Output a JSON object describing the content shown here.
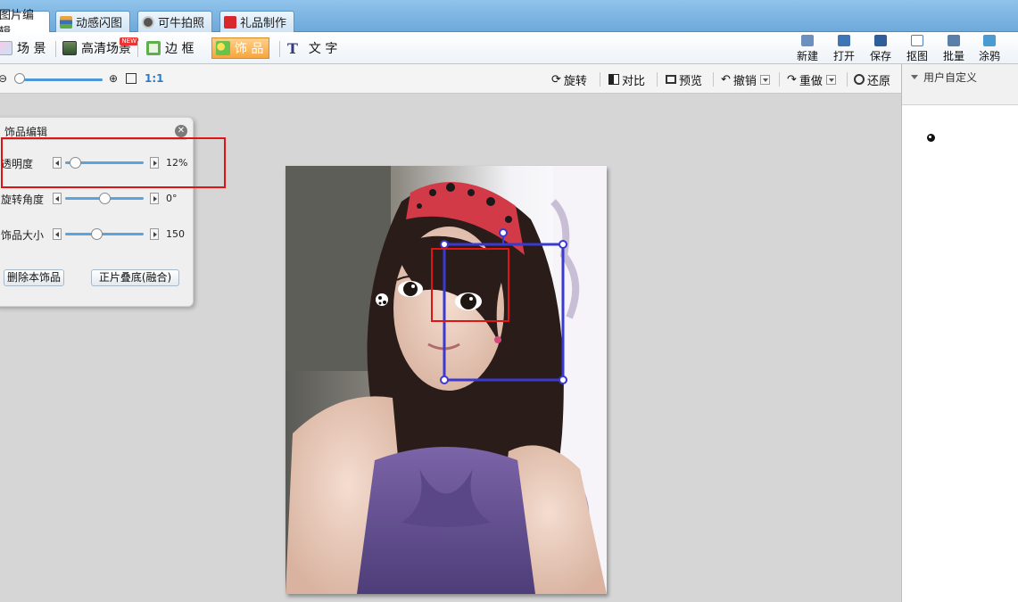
{
  "tabs": [
    {
      "label": "图片编辑",
      "active": true
    },
    {
      "label": "动感闪图",
      "active": false
    },
    {
      "label": "可牛拍照",
      "active": false
    },
    {
      "label": "礼品制作",
      "active": false
    }
  ],
  "modes": [
    {
      "label": "场 景"
    },
    {
      "label": "高清场景",
      "badge": "NEW"
    },
    {
      "label": "边 框"
    },
    {
      "label": "饰 品",
      "active": true
    },
    {
      "label": "文 字"
    }
  ],
  "right_tools": [
    {
      "label": "新建"
    },
    {
      "label": "打开"
    },
    {
      "label": "保存"
    },
    {
      "label": "抠图"
    },
    {
      "label": "批量"
    },
    {
      "label": "涂鸦"
    }
  ],
  "zoom": {
    "ratio_label": "1:1"
  },
  "actions": {
    "rotate": "旋转",
    "contrast": "对比",
    "preview": "预览",
    "undo": "撤销",
    "redo": "重做",
    "restore": "还原"
  },
  "right_panel": {
    "title": "用户自定义"
  },
  "edit_panel": {
    "title": "饰品编辑",
    "rows": [
      {
        "label": "透明度",
        "value": "12%",
        "level": 0.12
      },
      {
        "label": "旋转角度",
        "value": "0°",
        "level": 0.5
      },
      {
        "label": "饰品大小",
        "value": "150",
        "level": 0.4
      }
    ],
    "delete_button": "删除本饰品",
    "blend_button": "正片叠底(融合)"
  },
  "colors": {
    "tab_bar": "#7bb3e2",
    "active_mode": "#f7a53c",
    "highlight_red": "#e01414",
    "selection_blue": "#3a3ad0",
    "slider_blue": "#5aa3dc"
  }
}
